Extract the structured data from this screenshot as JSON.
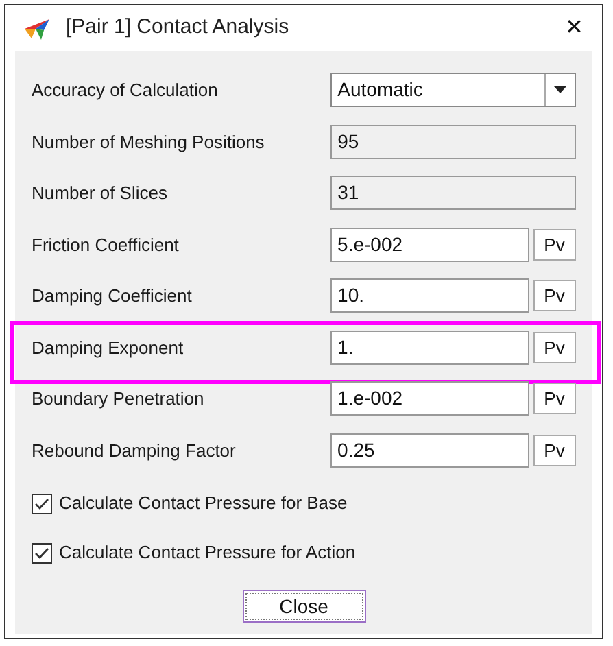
{
  "window": {
    "title": "[Pair 1] Contact Analysis",
    "close": "✕"
  },
  "rows": [
    {
      "kind": "dropdown",
      "label": "Accuracy of Calculation",
      "value": "Automatic",
      "highlighted": false
    },
    {
      "kind": "readonly",
      "label": "Number of Meshing Positions",
      "value": "95",
      "highlighted": false
    },
    {
      "kind": "readonly",
      "label": "Number of Slices",
      "value": "31",
      "highlighted": false
    },
    {
      "kind": "input",
      "label": "Friction Coefficient",
      "value": "5.e-002",
      "button": "Pv",
      "highlighted": false
    },
    {
      "kind": "input",
      "label": "Damping Coefficient",
      "value": "10.",
      "button": "Pv",
      "highlighted": false
    },
    {
      "kind": "input",
      "label": "Damping Exponent",
      "value": "1.",
      "button": "Pv",
      "highlighted": true
    },
    {
      "kind": "input",
      "label": "Boundary Penetration",
      "value": "1.e-002",
      "button": "Pv",
      "highlighted": false
    },
    {
      "kind": "input",
      "label": "Rebound Damping Factor",
      "value": "0.25",
      "button": "Pv",
      "highlighted": false
    }
  ],
  "checkboxes": [
    {
      "label": "Calculate Contact Pressure for Base",
      "checked": true
    },
    {
      "label": "Calculate Contact Pressure for Action",
      "checked": true
    }
  ],
  "buttons": [
    "Close"
  ]
}
